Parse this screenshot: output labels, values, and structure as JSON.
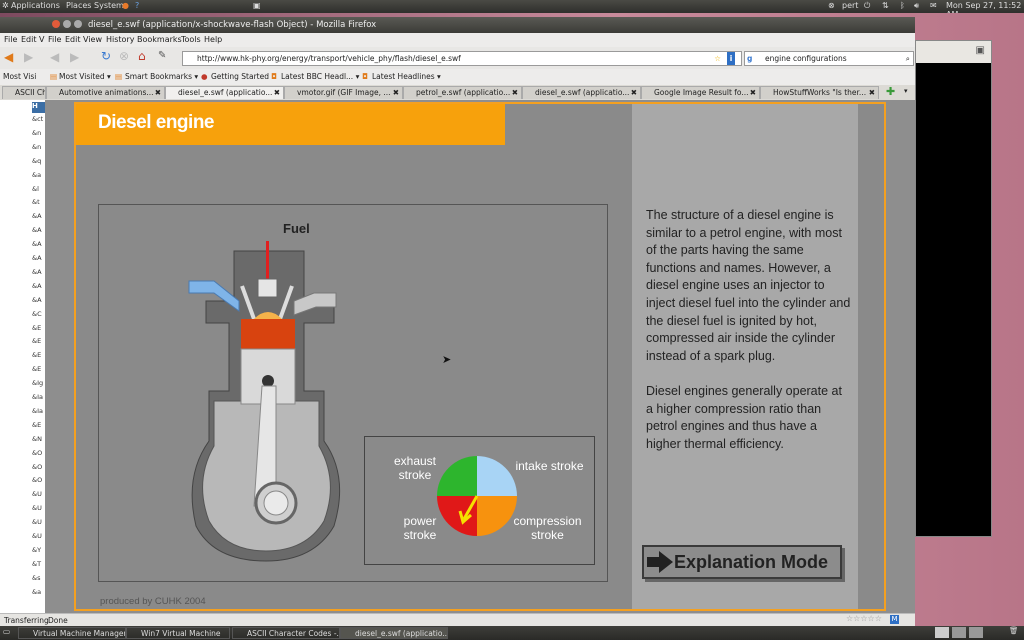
{
  "top_panel": {
    "menus": [
      "Applications",
      "Places",
      "System"
    ],
    "user": "pert",
    "clock": "Mon Sep 27, 11:52 AM"
  },
  "window": {
    "title": "diesel_e.swf (application/x-shockwave-flash Object) - Mozilla Firefox"
  },
  "menubar": {
    "side_items": [
      "File",
      "Edit",
      "V"
    ],
    "items": [
      "File",
      "Edit",
      "View",
      "History",
      "Bookmarks",
      "Tools",
      "Help"
    ]
  },
  "navbar": {
    "url": "http://www.hk-phy.org/energy/transport/vehicle_phy/flash/diesel_e.swf",
    "search_value": "engine configurations"
  },
  "bookmarks": {
    "side_item": "Most Visi",
    "items": [
      "Most Visited ▾",
      "Smart Bookmarks ▾",
      "Getting Started",
      "Latest BBC Headl... ▾",
      "Latest Headlines ▾"
    ]
  },
  "tabs": {
    "side_tab": "ASCII Ch",
    "items": [
      {
        "label": "Automotive animations..."
      },
      {
        "label": "diesel_e.swf (applicatio..."
      },
      {
        "label": "vmotor.gif (GIF Image, ..."
      },
      {
        "label": "petrol_e.swf (applicatio..."
      },
      {
        "label": "diesel_e.swf (applicatio..."
      },
      {
        "label": "Google Image Result fo..."
      },
      {
        "label": "HowStuffWorks \"Is ther..."
      }
    ]
  },
  "sidebar": {
    "header": "H",
    "rows": [
      "&ct",
      "&n",
      "&n",
      "&q",
      "&a",
      "&l",
      "&t",
      "&A",
      "&A",
      "&A",
      "&A",
      "&A",
      "&A",
      "&A",
      "&C",
      "&E",
      "&E",
      "&E",
      "&E",
      "&Ig",
      "&Ia",
      "&Ia",
      "&E",
      "&N",
      "&O",
      "&O",
      "&O",
      "&U",
      "&U",
      "&U",
      "&U",
      "&Y",
      "&T",
      "&s",
      "&a"
    ]
  },
  "flash": {
    "title": "Diesel engine",
    "fuel_label": "Fuel",
    "description_p1": "The structure of a diesel engine is similar to a petrol engine, with most of the parts having the same functions and names. However, a diesel engine uses an injector to inject diesel fuel into the cylinder and the diesel fuel is ignited by hot, compressed air inside the cylinder instead of a spark plug.",
    "description_p2": "Diesel engines generally operate at a higher compression ratio than petrol engines and thus have a higher thermal efficiency.",
    "legend": {
      "exhaust": "exhaust\nstroke",
      "intake": "intake stroke",
      "power": "power\nstroke",
      "compression": "compression\nstroke",
      "colors": {
        "exhaust": "#2db52d",
        "intake": "#a8d4f5",
        "power": "#e01818",
        "compression": "#f7920e"
      }
    },
    "button_label": "Explanation Mode",
    "credit": "produced by CUHK 2004"
  },
  "statusbar": {
    "left": "Transferring",
    "text": "Done"
  },
  "taskbar": {
    "items": [
      {
        "label": "Virtual Machine Manager"
      },
      {
        "label": "Win7 Virtual Machine"
      },
      {
        "label": "ASCII Character Codes -..."
      },
      {
        "label": "diesel_e.swf (applicatio..."
      }
    ]
  }
}
